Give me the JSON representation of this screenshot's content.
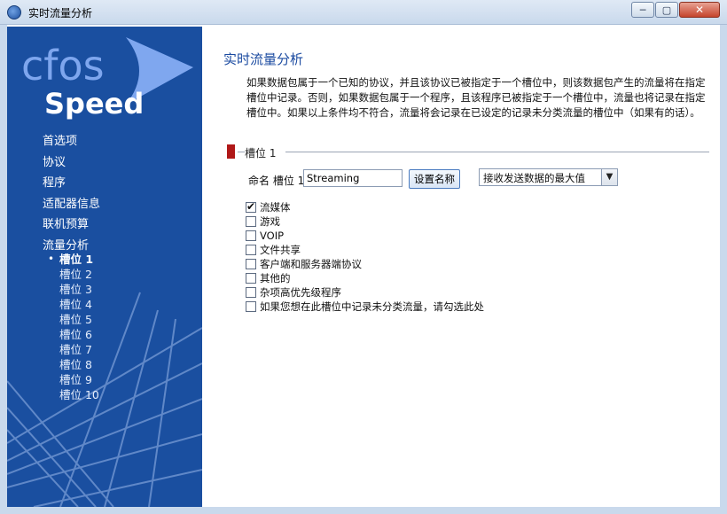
{
  "window": {
    "title": "实时流量分析",
    "controls": {
      "minimize": "─",
      "maximize": "▢",
      "close": "✕"
    }
  },
  "logo": {
    "line1": "cfos",
    "line2": "Speed"
  },
  "sidebar": {
    "items": [
      {
        "label": "首选项"
      },
      {
        "label": "协议"
      },
      {
        "label": "程序"
      },
      {
        "label": "适配器信息"
      },
      {
        "label": "联机预算"
      },
      {
        "label": "流量分析"
      }
    ],
    "bullet": "•",
    "subitems": [
      {
        "label": "槽位 1",
        "active": true
      },
      {
        "label": "槽位 2"
      },
      {
        "label": "槽位 3"
      },
      {
        "label": "槽位 4"
      },
      {
        "label": "槽位 5"
      },
      {
        "label": "槽位 6"
      },
      {
        "label": "槽位 7"
      },
      {
        "label": "槽位 8"
      },
      {
        "label": "槽位 9"
      },
      {
        "label": "槽位 10"
      }
    ]
  },
  "main": {
    "title": "实时流量分析",
    "description": "如果数据包属于一个已知的协议，并且该协议已被指定于一个槽位中，则该数据包产生的流量将在指定槽位中记录。否则，如果数据包属于一个程序，且该程序已被指定于一个槽位中，流量也将记录在指定槽位中。如果以上条件均不符合，流量将会记录在已设定的记录未分类流量的槽位中（如果有的话）。",
    "section_title": "槽位 1",
    "name_label": "命名 槽位 1",
    "name_value": "Streaming",
    "set_name_button": "设置名称",
    "select_value": "接收发送数据的最大值",
    "select_arrow": "▼",
    "checkboxes": [
      {
        "label": "流媒体",
        "checked": true
      },
      {
        "label": "游戏",
        "checked": false
      },
      {
        "label": "VOIP",
        "checked": false
      },
      {
        "label": "文件共享",
        "checked": false
      },
      {
        "label": "客户端和服务器端协议",
        "checked": false
      },
      {
        "label": "其他的",
        "checked": false
      },
      {
        "label": "杂项高优先级程序",
        "checked": false
      },
      {
        "label": "如果您想在此槽位中记录未分类流量，请勾选此处",
        "checked": false
      }
    ]
  },
  "colors": {
    "sidebar_bg": "#1a4fa0",
    "title_color": "#1a4aa0",
    "section_accent": "#b01818"
  }
}
